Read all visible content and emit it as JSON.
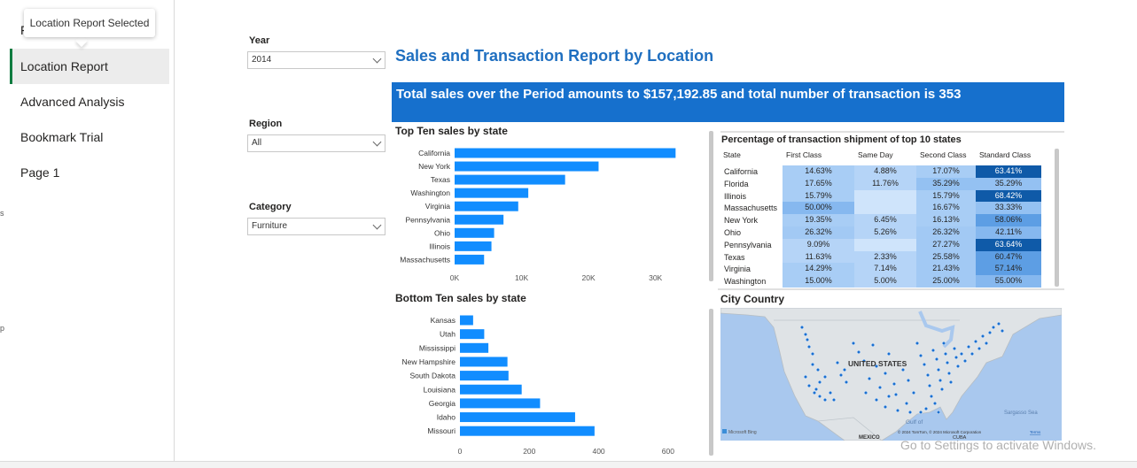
{
  "nav": {
    "tooltip": "Location Report Selected",
    "partial_item": "F",
    "items": [
      "Location Report",
      "Advanced Analysis",
      "Bookmark Trial",
      "Page 1"
    ],
    "edge_marks": [
      "s",
      "p"
    ]
  },
  "slicers": {
    "year": {
      "label": "Year",
      "value": "2014"
    },
    "region": {
      "label": "Region",
      "value": "All"
    },
    "category": {
      "label": "Category",
      "value": "Furniture"
    }
  },
  "report": {
    "title": "Sales and Transaction Report by Location",
    "banner": "Total sales over the Period amounts to $157,192.85 and total number of transaction is 353",
    "accent_color": "#1670cd",
    "bar_color": "#118dff"
  },
  "chart_data": [
    {
      "type": "bar",
      "orientation": "horizontal",
      "title": "Top Ten sales by state",
      "categories": [
        "California",
        "New York",
        "Texas",
        "Washington",
        "Virginia",
        "Pennsylvania",
        "Ohio",
        "Illinois",
        "Massachusetts"
      ],
      "values": [
        33000,
        21500,
        16500,
        11000,
        9500,
        7300,
        5900,
        5500,
        4400
      ],
      "xticks": [
        0,
        10000,
        20000,
        30000
      ],
      "xtick_labels": [
        "0K",
        "10K",
        "20K",
        "30K"
      ],
      "xlim": [
        0,
        36000
      ]
    },
    {
      "type": "bar",
      "orientation": "horizontal",
      "title": "Bottom Ten sales by state",
      "categories": [
        "Kansas",
        "Utah",
        "Mississippi",
        "New Hampshire",
        "South Dakota",
        "Louisiana",
        "Georgia",
        "Idaho",
        "Missouri"
      ],
      "values": [
        38,
        70,
        82,
        137,
        140,
        178,
        231,
        332,
        388
      ],
      "xticks": [
        0,
        200,
        400,
        600
      ],
      "xtick_labels": [
        "0",
        "200",
        "400",
        "600"
      ],
      "xlim": [
        0,
        700
      ]
    },
    {
      "type": "table",
      "title": "Percentage of transaction shipment of top 10 states",
      "columns": [
        "State",
        "First Class",
        "Same Day",
        "Second Class",
        "Standard Class"
      ],
      "rows": [
        [
          "California",
          "14.63%",
          "4.88%",
          "17.07%",
          "63.41%"
        ],
        [
          "Florida",
          "17.65%",
          "11.76%",
          "35.29%",
          "35.29%"
        ],
        [
          "Illinois",
          "15.79%",
          "",
          "15.79%",
          "68.42%"
        ],
        [
          "Massachusetts",
          "50.00%",
          "",
          "16.67%",
          "33.33%"
        ],
        [
          "New York",
          "19.35%",
          "6.45%",
          "16.13%",
          "58.06%"
        ],
        [
          "Ohio",
          "26.32%",
          "5.26%",
          "26.32%",
          "42.11%"
        ],
        [
          "Pennsylvania",
          "9.09%",
          "",
          "27.27%",
          "63.64%"
        ],
        [
          "Texas",
          "11.63%",
          "2.33%",
          "25.58%",
          "60.47%"
        ],
        [
          "Virginia",
          "14.29%",
          "7.14%",
          "21.43%",
          "57.14%"
        ],
        [
          "Washington",
          "15.00%",
          "5.00%",
          "25.00%",
          "55.00%"
        ]
      ]
    }
  ],
  "map": {
    "title": "City Country",
    "label_country": "UNITED STATES",
    "label_mexico": "MEXICO",
    "label_cuba": "CUBA",
    "label_gulf": "Gulf of",
    "label_sargasso": "Sargasso Sea",
    "logo": "Microsoft Bing",
    "attribution": "© 2024 TomTom, © 2024 Microsoft Corporation",
    "terms": "Terms",
    "water_color": "#a9c8ee",
    "land_color": "#dfe3e6",
    "point_color": "#1a6fd0"
  },
  "watermark": "Go to Settings to activate Windows."
}
